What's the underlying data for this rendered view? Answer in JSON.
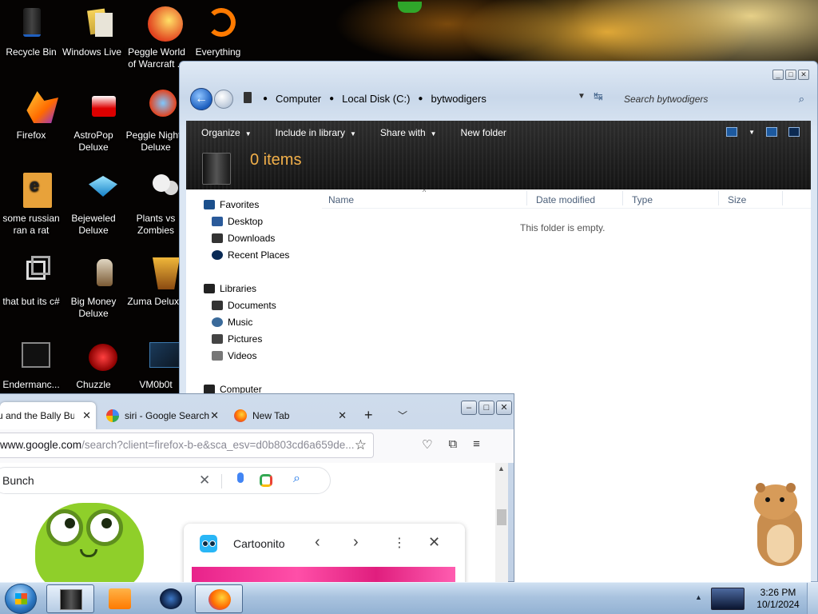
{
  "desktop": {
    "icons": [
      {
        "label": "Recycle Bin"
      },
      {
        "label": "Windows Live Mail"
      },
      {
        "label": "Peggle World of Warcraft ..."
      },
      {
        "label": "Everything"
      },
      {
        "label": "Firefox"
      },
      {
        "label": "AstroPop Deluxe"
      },
      {
        "label": "Peggle Nights Deluxe"
      },
      {
        "label": "some russian ran a rat"
      },
      {
        "label": "Bejeweled Deluxe"
      },
      {
        "label": "Plants vs Zombies"
      },
      {
        "label": "that but its c#"
      },
      {
        "label": "Big Money Deluxe"
      },
      {
        "label": "Zuma Deluxe"
      },
      {
        "label": "Endermanc..."
      },
      {
        "label": "Chuzzle"
      },
      {
        "label": "VM0b0t"
      }
    ]
  },
  "explorer": {
    "breadcrumb": [
      "Computer",
      "Local Disk (C:)",
      "bytwodigers"
    ],
    "search_placeholder": "Search bytwodigers",
    "toolbar": {
      "organize": "Organize",
      "include_in_library": "Include in library",
      "share_with": "Share with",
      "new_folder": "New folder"
    },
    "item_count": "0 items",
    "nav": {
      "favorites": "Favorites",
      "desktop": "Desktop",
      "downloads": "Downloads",
      "recent_places": "Recent Places",
      "libraries": "Libraries",
      "documents": "Documents",
      "music": "Music",
      "pictures": "Pictures",
      "videos": "Videos",
      "computer": "Computer"
    },
    "columns": {
      "name": "Name",
      "date_modified": "Date modified",
      "type": "Type",
      "size": "Size"
    },
    "empty_message": "This folder is empty."
  },
  "firefox": {
    "tabs": [
      {
        "title": "u and the Bally Bunch"
      },
      {
        "title": "siri - Google Search"
      },
      {
        "title": "New Tab"
      }
    ],
    "url": {
      "main": "www.google.com",
      "rest": "/search?client=firefox-b-e&sca_esv=d0b803cd6a659de..."
    },
    "search_query": "Bunch",
    "card_title": "Cartoonito"
  },
  "taskbar": {
    "time": "3:26 PM",
    "date": "10/1/2024"
  },
  "colors": {
    "items_count": "#f2b04a",
    "taskbar": "#a9c3df",
    "toolbar_dark": "#1a1a1a"
  }
}
